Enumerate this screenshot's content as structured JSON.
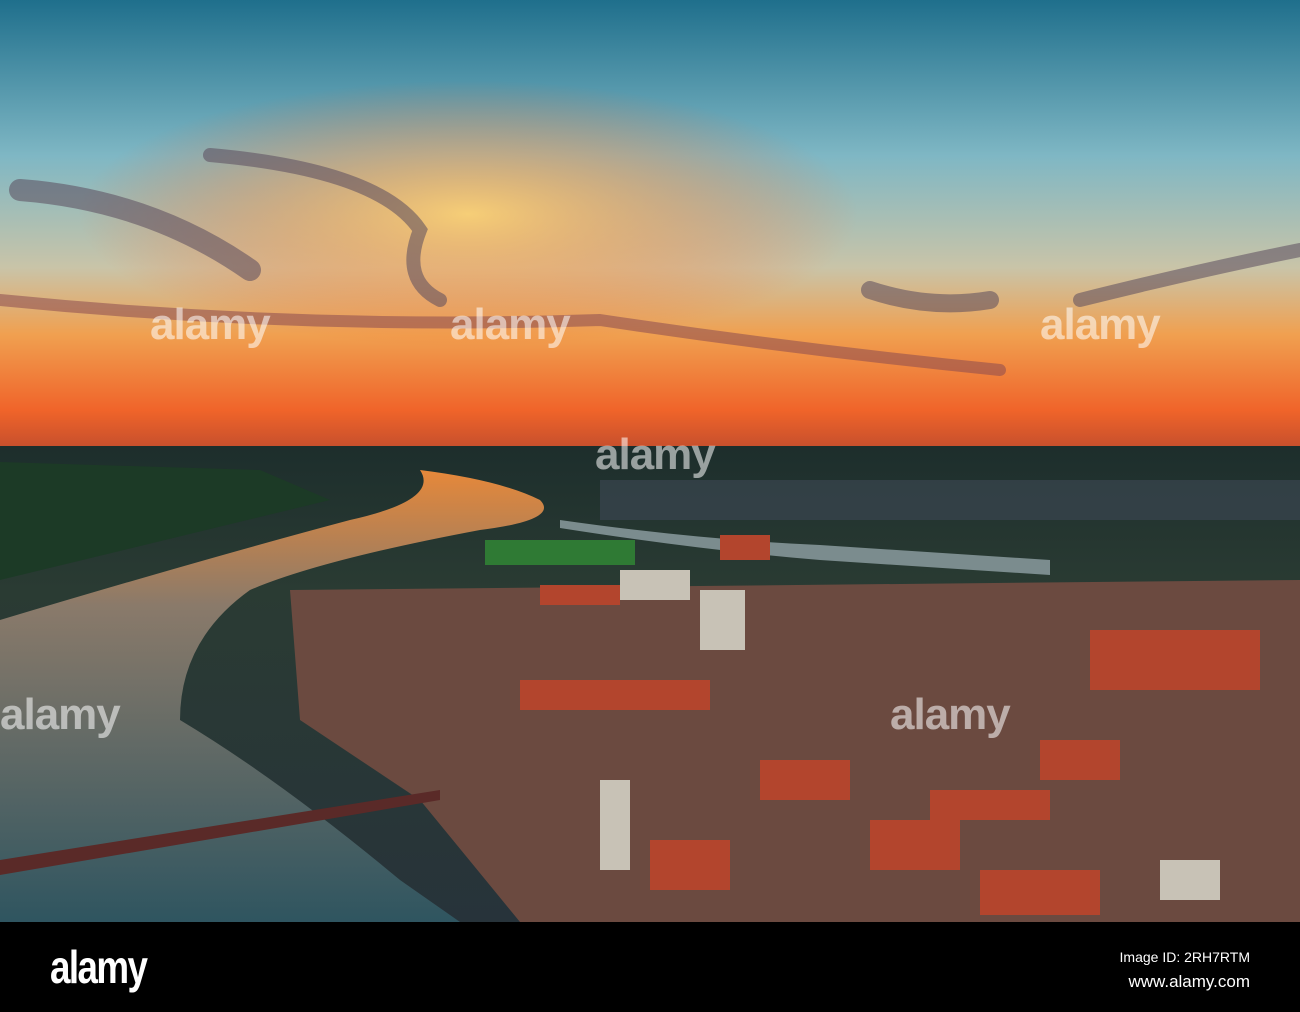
{
  "watermark": {
    "text": "alamy"
  },
  "footer": {
    "logo": "alamy",
    "image_id": "Image ID: 2RH7RTM",
    "url": "www.alamy.com"
  },
  "colors": {
    "sky_top": "#2a7d96",
    "sunset": "#f0642a",
    "river": "#4f6f7a",
    "roofs": "#b3452d"
  }
}
